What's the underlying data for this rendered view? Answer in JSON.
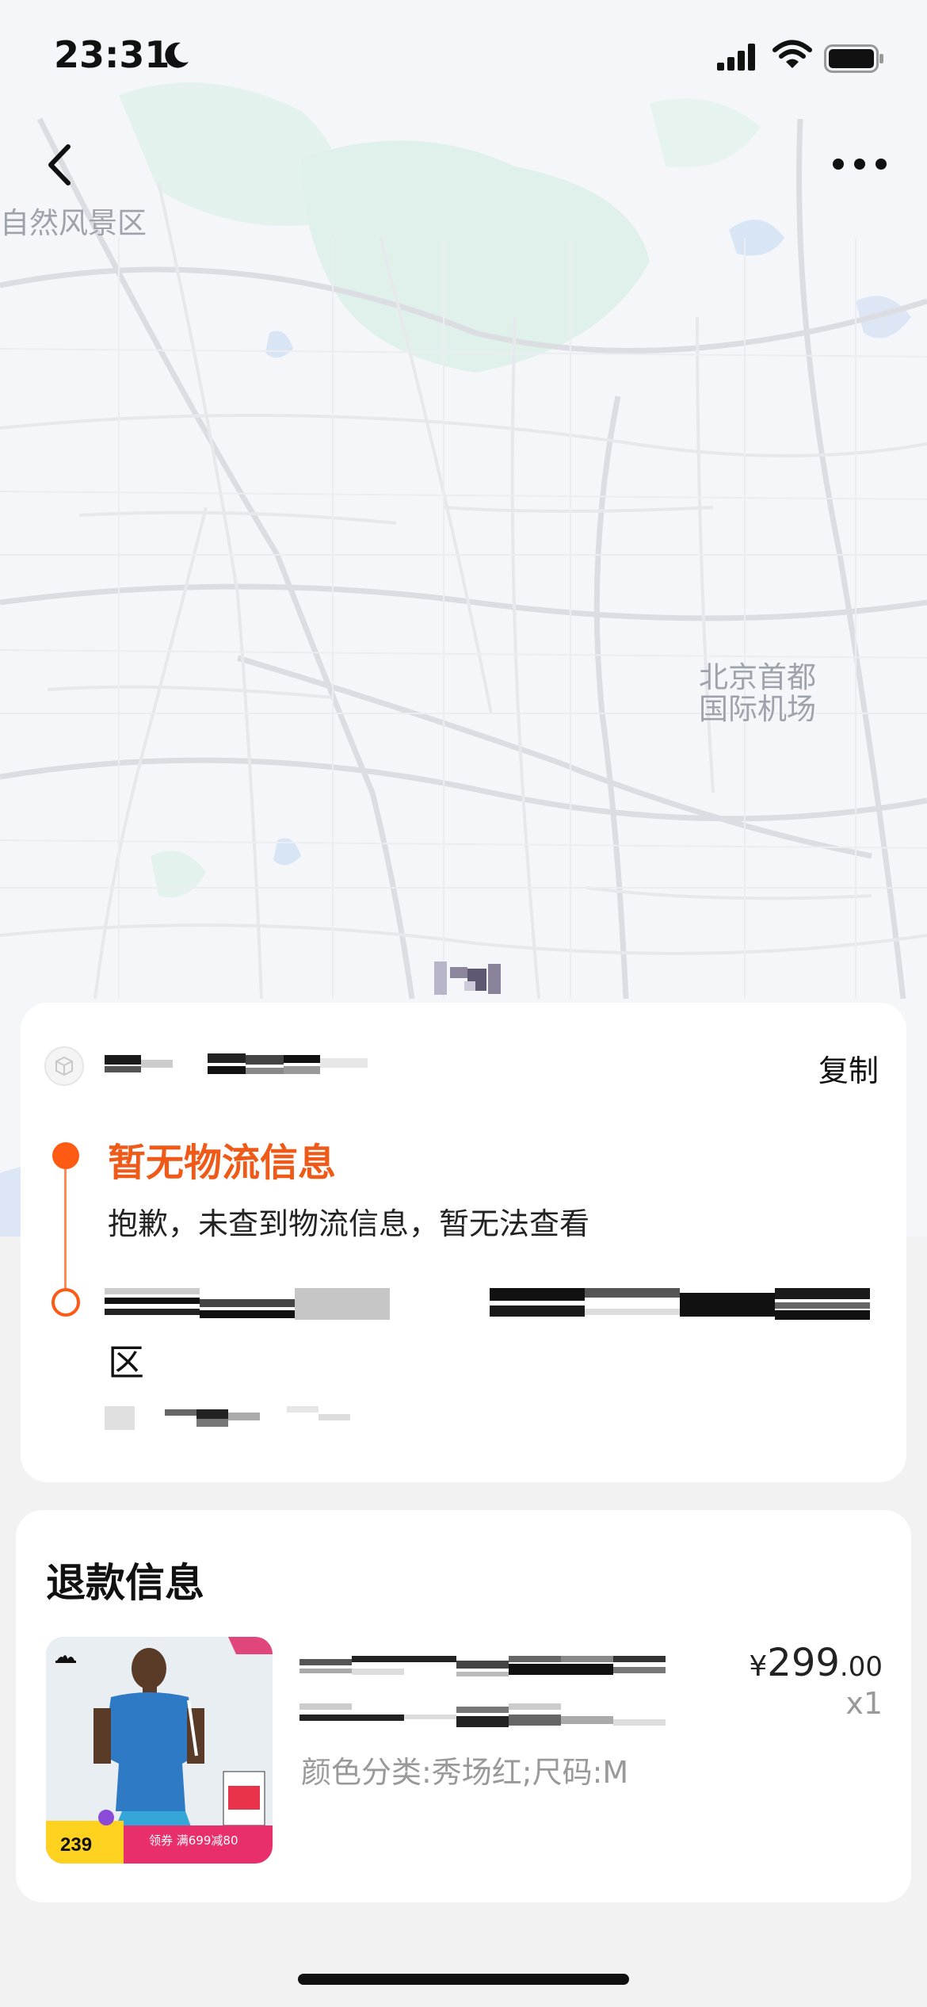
{
  "status_bar": {
    "time": "23:31",
    "moon_icon": "moon-icon",
    "signal_icon": "cellular-signal-icon",
    "wifi_icon": "wifi-icon",
    "battery_icon": "battery-icon"
  },
  "nav": {
    "back_icon": "chevron-left-icon",
    "more_icon": "more-dots-icon"
  },
  "map": {
    "labels": [
      {
        "text": "自然风景区"
      },
      {
        "text": "北京首都"
      },
      {
        "text": "国际机场"
      }
    ]
  },
  "tracking": {
    "package_icon": "package-icon",
    "copy_label": "复制",
    "status_title": "暂无物流信息",
    "status_desc": "抱歉，未查到物流信息，暂无法查看",
    "address_tail": "区",
    "accent_color": "#ff5a14"
  },
  "refund": {
    "title": "退款信息",
    "price_symbol": "¥",
    "price_int": "299",
    "price_dec": ".00",
    "quantity": "x1",
    "sku": "颜色分类:秀场红;尺码:M",
    "product_image": {
      "badge_price": "239",
      "coupon_text": "领券 满699减80"
    }
  }
}
